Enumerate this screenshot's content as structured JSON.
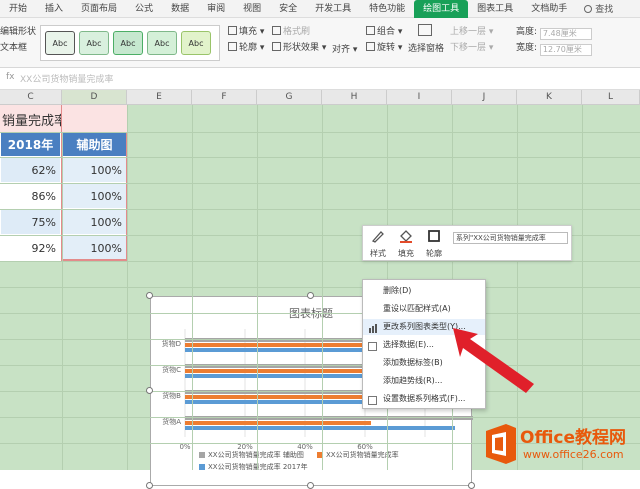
{
  "ribbon_tabs": [
    "开始",
    "插入",
    "页面布局",
    "公式",
    "数据",
    "审阅",
    "视图",
    "安全",
    "开发工具",
    "特色功能",
    "绘图工具",
    "图表工具",
    "文档助手"
  ],
  "active_tab": "绘图工具",
  "search_label": "查找",
  "ribbon": {
    "left_labels": [
      "编辑形状",
      "文本框"
    ],
    "style_label": "Abc",
    "fill_label": "填充",
    "format_brush": "格式刷",
    "outline_label": "轮廓",
    "shape_effect": "形状效果",
    "align_label": "对齐",
    "group_label": "组合",
    "rotate_label": "旋转",
    "selection_pane": "选择窗格",
    "bring_forward": "上移一层",
    "send_backward": "下移一层",
    "height_label": "高度:",
    "height_value": "7.48厘米",
    "width_label": "宽度:",
    "width_value": "12.70厘米"
  },
  "formula_bar": {
    "fx": "fx",
    "content": "XX公司货物销量完成率"
  },
  "columns": [
    "C",
    "D",
    "E",
    "F",
    "G",
    "H",
    "I",
    "J",
    "K",
    "L"
  ],
  "table": {
    "title": "销量完成率",
    "headers": [
      "2018年",
      "辅助图"
    ],
    "rows": [
      [
        "62%",
        "100%"
      ],
      [
        "86%",
        "100%"
      ],
      [
        "75%",
        "100%"
      ],
      [
        "92%",
        "100%"
      ]
    ]
  },
  "chart_data": {
    "type": "bar",
    "orientation": "horizontal",
    "title": "图表标题",
    "categories": [
      "货物A",
      "货物B",
      "货物C",
      "货物D"
    ],
    "series": [
      {
        "name": "XX公司货物销量完成率 辅助图",
        "color": "#a5a5a5",
        "values": [
          1.0,
          1.0,
          1.0,
          1.0
        ]
      },
      {
        "name": "XX公司货物销量完成率",
        "color": "#ed7d31",
        "values": [
          0.62,
          0.86,
          0.75,
          0.92
        ]
      },
      {
        "name": "XX公司货物销量完成率 2017年",
        "color": "#5b9bd5",
        "values": [
          0.9,
          0.85,
          0.8,
          0.78
        ]
      }
    ],
    "x_ticks": [
      "0%",
      "20%",
      "40%",
      "60%"
    ],
    "xlim": [
      0,
      1.0
    ],
    "legend": "bottom"
  },
  "float_toolbar": {
    "style_label": "样式",
    "fill_label": "填充",
    "outline_label": "轮廓",
    "series_label": "系列\"XX公司货物销量完成率"
  },
  "context_menu": [
    {
      "label": "删除(D)",
      "highlighted": false
    },
    {
      "label": "重设以匹配样式(A)",
      "highlighted": false
    },
    {
      "label": "更改系列图表类型(Y)...",
      "highlighted": true
    },
    {
      "label": "选择数据(E)...",
      "highlighted": false
    },
    {
      "label": "添加数据标签(B)",
      "highlighted": false
    },
    {
      "label": "添加趋势线(R)...",
      "highlighted": false
    },
    {
      "label": "设置数据系列格式(F)...",
      "highlighted": false
    }
  ],
  "logo": {
    "name": "Office教程网",
    "url": "www.office26.com"
  },
  "colors": {
    "accent": "#18a058",
    "arrow": "#e0202a",
    "logo": "#e8590c",
    "header_blue": "#4a7fc1"
  }
}
